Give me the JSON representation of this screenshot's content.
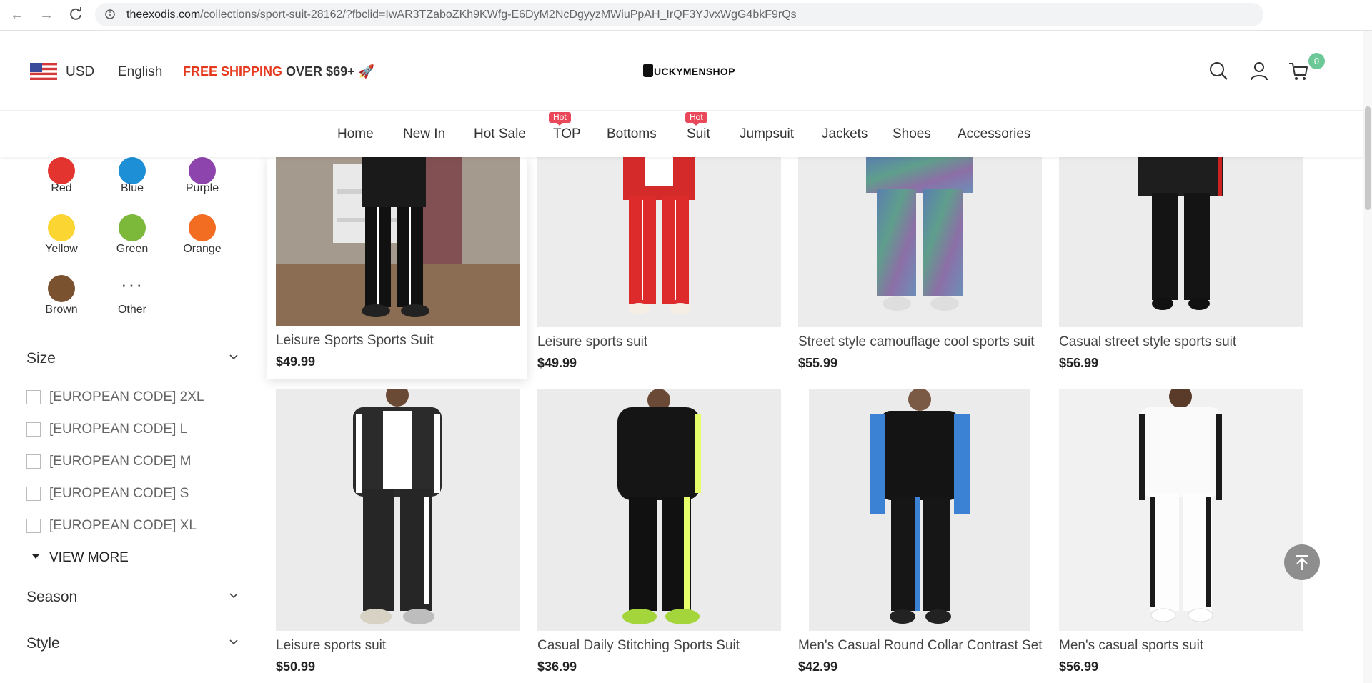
{
  "browser": {
    "url_host": "theexodis.com",
    "url_path": "/collections/sport-suit-28162/?fbclid=IwAR3TZaboZKh9KWfg-E6DyM2NcDgyyzMWiuPpAH_IrQF3YJvxWgG4bkF9rQs"
  },
  "header": {
    "currency": "USD",
    "language": "English",
    "shipping_red": "FREE SHIPPING",
    "shipping_rest": "OVER $69+",
    "shipping_icon": "rocket-icon",
    "logo_text": "UCKYMENSHOP",
    "cart_count": "0"
  },
  "nav": {
    "items": [
      {
        "label": "Home"
      },
      {
        "label": "New In"
      },
      {
        "label": "Hot Sale"
      },
      {
        "label": "TOP",
        "badge": "Hot"
      },
      {
        "label": "Bottoms"
      },
      {
        "label": "Suit",
        "badge": "Hot"
      },
      {
        "label": "Jumpsuit"
      },
      {
        "label": "Jackets"
      },
      {
        "label": "Shoes"
      },
      {
        "label": "Accessories"
      }
    ]
  },
  "sidebar": {
    "colors": [
      {
        "label": "Red",
        "hex": "#e3342f"
      },
      {
        "label": "Blue",
        "hex": "#1d8fd6"
      },
      {
        "label": "Purple",
        "hex": "#8e44ad"
      },
      {
        "label": "Yellow",
        "hex": "#fbd532"
      },
      {
        "label": "Green",
        "hex": "#7cb83a"
      },
      {
        "label": "Orange",
        "hex": "#f26c22"
      },
      {
        "label": "Brown",
        "hex": "#7a5230"
      },
      {
        "label": "Other",
        "hex": ""
      }
    ],
    "size_title": "Size",
    "sizes": [
      "[EUROPEAN CODE] 2XL",
      "[EUROPEAN CODE] L",
      "[EUROPEAN CODE] M",
      "[EUROPEAN CODE] S",
      "[EUROPEAN CODE] XL"
    ],
    "view_more": "VIEW MORE",
    "season_title": "Season",
    "style_title": "Style"
  },
  "products": [
    {
      "name": "Leisure Sports Sports Suit",
      "price": "$49.99"
    },
    {
      "name": "Leisure sports suit",
      "price": "$49.99"
    },
    {
      "name": "Street style camouflage cool sports suit",
      "price": "$55.99"
    },
    {
      "name": "Casual street style sports suit",
      "price": "$56.99"
    },
    {
      "name": "Leisure sports suit",
      "price": "$50.99"
    },
    {
      "name": "Casual Daily Stitching Sports Suit",
      "price": "$36.99"
    },
    {
      "name": "Men's Casual Round Collar Contrast Set",
      "price": "$42.99"
    },
    {
      "name": "Men's casual sports suit",
      "price": "$56.99"
    }
  ]
}
